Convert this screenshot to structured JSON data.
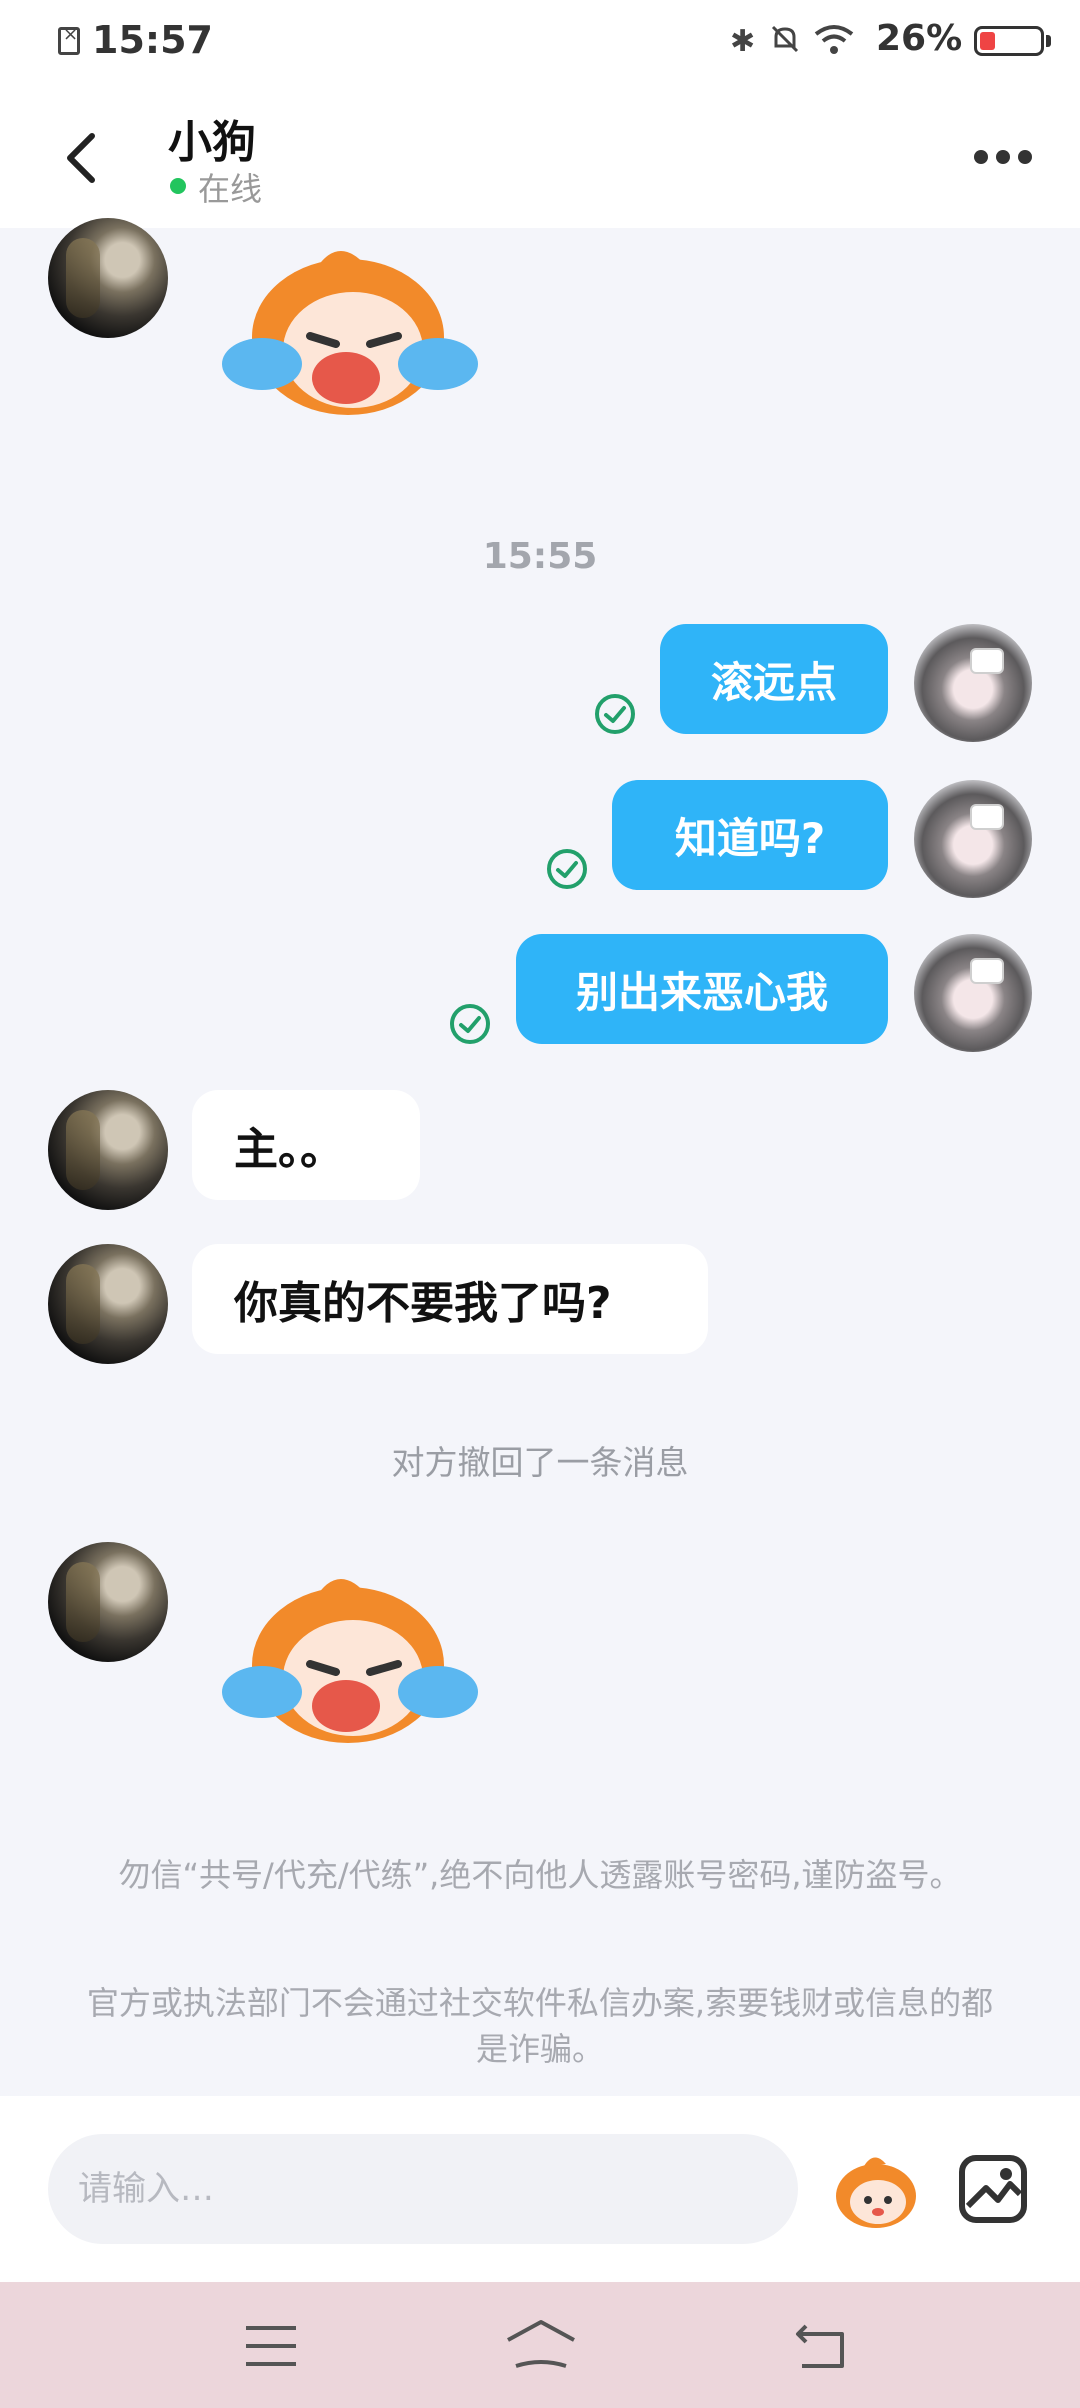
{
  "status_bar": {
    "time": "15:57",
    "battery": "26%",
    "battery_level": 0.26
  },
  "header": {
    "title": "小狗",
    "status": "在线"
  },
  "messages": {
    "timestamp": "15:55",
    "sent": [
      "滚远点",
      "知道吗?",
      "别出来恶心我"
    ],
    "received": [
      "主。。",
      "你真的不要我了吗?"
    ],
    "recall_notice": "对方撤回了一条消息"
  },
  "notice": {
    "line1": "勿信“共号/代充/代练”,绝不向他人透露账号密码,谨防盗号。",
    "line2": "官方或执法部门不会通过社交软件私信办案,索要钱财或信息的都是诈骗。"
  },
  "input": {
    "placeholder": "请输入…"
  },
  "colors": {
    "accent": "#2fb4f8",
    "online": "#22c55e",
    "check": "#22a06b",
    "navbar": "#ecd6db"
  }
}
